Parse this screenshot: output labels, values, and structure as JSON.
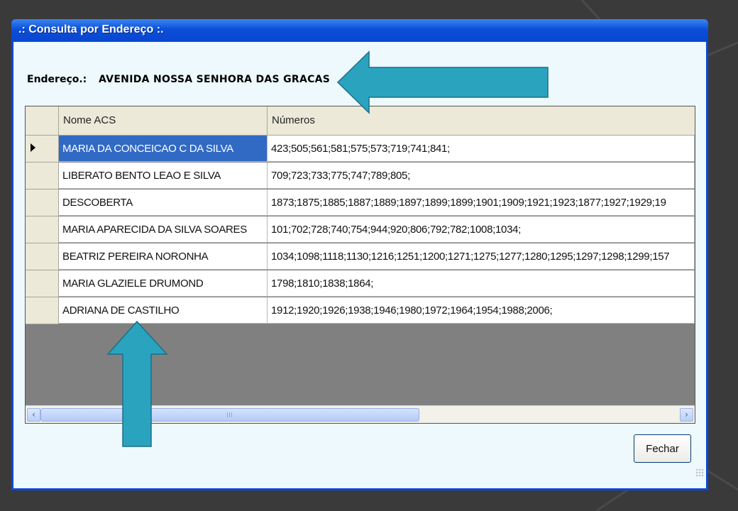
{
  "window": {
    "title": ".: Consulta por Endereço :."
  },
  "address": {
    "label": "Endereço.:",
    "value": "AVENIDA NOSSA SENHORA DAS GRACAS"
  },
  "grid": {
    "columns": [
      "Nome ACS",
      "Números"
    ],
    "selected_row": 0,
    "rows": [
      {
        "nome": "MARIA DA CONCEICAO C DA SILVA",
        "numeros": "423;505;561;581;575;573;719;741;841;"
      },
      {
        "nome": "LIBERATO BENTO LEAO E SILVA",
        "numeros": "709;723;733;775;747;789;805;"
      },
      {
        "nome": "DESCOBERTA",
        "numeros": "1873;1875;1885;1887;1889;1897;1899;1899;1901;1909;1921;1923;1877;1927;1929;19"
      },
      {
        "nome": "MARIA APARECIDA DA SILVA SOARES",
        "numeros": "101;702;728;740;754;944;920;806;792;782;1008;1034;"
      },
      {
        "nome": "BEATRIZ PEREIRA NORONHA",
        "numeros": "1034;1098;1118;1130;1216;1251;1200;1271;1275;1277;1280;1295;1297;1298;1299;157"
      },
      {
        "nome": "MARIA GLAZIELE DRUMOND",
        "numeros": "1798;1810;1838;1864;"
      },
      {
        "nome": "ADRIANA DE CASTILHO",
        "numeros": "1912;1920;1926;1938;1946;1980;1972;1964;1954;1988;2006;"
      }
    ]
  },
  "buttons": {
    "fechar": "Fechar"
  },
  "icons": {
    "scroll_left": "scroll-left-arrow-icon",
    "scroll_right": "scroll-right-arrow-icon",
    "row_indicator": "row-pointer-icon",
    "annotation_left": "arrow-left-annotation",
    "annotation_up": "arrow-up-annotation"
  },
  "colors": {
    "titlebar": "#0b4fd8",
    "selection": "#316ac5",
    "annotation_arrow": "#2aa3bf",
    "client_bg": "#edf9fd"
  }
}
